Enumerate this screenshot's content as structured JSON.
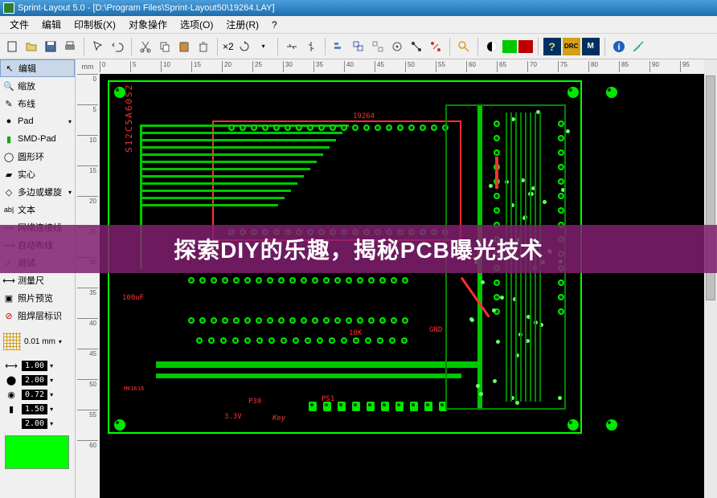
{
  "title": "Sprint-Layout 5.0 - [D:\\Program Files\\Sprint-Layout50\\19264.LAY]",
  "menu": {
    "file": "文件",
    "edit": "编辑",
    "pcb": "印制板(X)",
    "object": "对象操作",
    "options": "选项(O)",
    "register": "注册(R)",
    "help": "?"
  },
  "sidebar": {
    "items": [
      {
        "label": "编辑",
        "sel": true
      },
      {
        "label": "缩放"
      },
      {
        "label": "布线"
      },
      {
        "label": "Pad",
        "arrow": true
      },
      {
        "label": "SMD-Pad"
      },
      {
        "label": "圆形环"
      },
      {
        "label": "实心"
      },
      {
        "label": "多边或螺旋",
        "arrow": true
      },
      {
        "label": "文本"
      },
      {
        "label": "网络连接线"
      },
      {
        "label": "自动布线"
      },
      {
        "label": "测试"
      },
      {
        "label": "测量尺"
      },
      {
        "label": "照片预览"
      },
      {
        "label": "阻焊层标识"
      }
    ],
    "grid_val": "0.01 mm",
    "params": [
      {
        "v": "1.00"
      },
      {
        "v": "2.00"
      },
      {
        "v": "0.72"
      },
      {
        "v": "1.50"
      },
      {
        "v": "2.00"
      }
    ]
  },
  "ruler": {
    "unit": "mm",
    "h": [
      "0",
      "5",
      "10",
      "15",
      "20",
      "25",
      "30",
      "35",
      "40",
      "45",
      "50",
      "55",
      "60",
      "65",
      "70",
      "75",
      "80",
      "85",
      "90",
      "95"
    ],
    "v": [
      "0",
      "5",
      "10",
      "15",
      "20",
      "25",
      "30",
      "35",
      "40",
      "45",
      "50",
      "55",
      "60"
    ]
  },
  "silk": {
    "chip": "19264",
    "key": "Key",
    "v33": "3.3V",
    "res": "10K",
    "gnd": "GND",
    "part": "S12C5A60S2",
    "ps1": "PS1",
    "c1": "100uF",
    "p30": "P30",
    "ic2": "MK1616"
  },
  "overlay": "探索DIY的乐趣，揭秘PCB曝光技术",
  "toolbar_x2": "×2"
}
